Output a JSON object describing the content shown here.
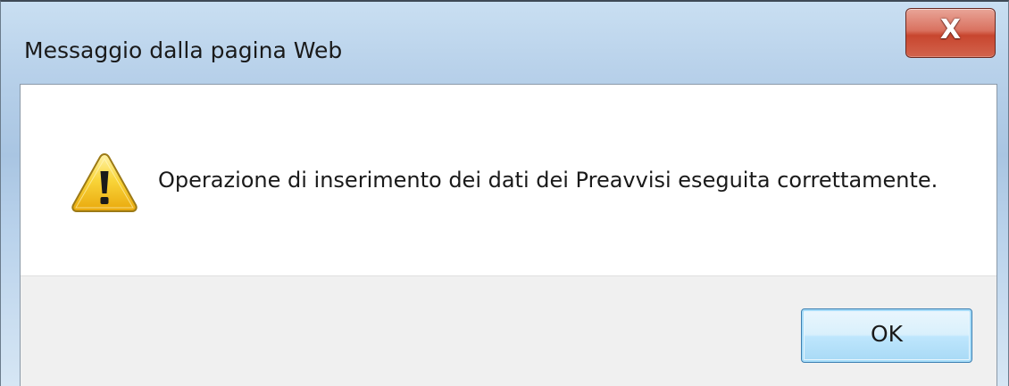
{
  "window": {
    "title": "Messaggio dalla pagina Web",
    "close_glyph": "X"
  },
  "dialog": {
    "icon": "warning-icon",
    "message": "Operazione di inserimento dei dati dei Preavvisi eseguita correttamente.",
    "ok_label": "OK"
  },
  "colors": {
    "frame": "#b8d1ea",
    "close_button": "#c8462f",
    "ok_button_border": "#3c7fb1",
    "warning_fill": "#f5c518",
    "footer": "#f0f0f0"
  }
}
